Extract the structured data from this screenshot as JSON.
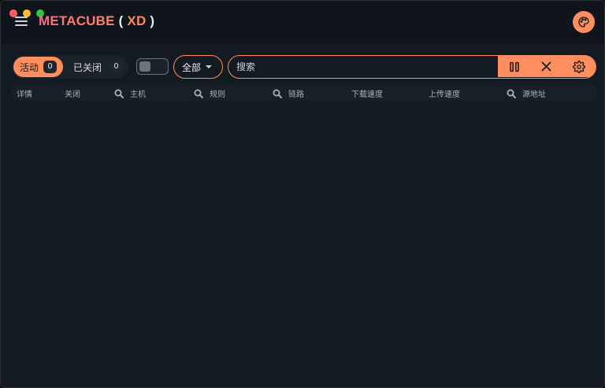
{
  "app": {
    "title_brand": "METACUBE",
    "title_open": "(",
    "title_variant": "XD",
    "title_close": ")"
  },
  "toolbar": {
    "tabs": [
      {
        "label": "活动",
        "count": "0",
        "active": true
      },
      {
        "label": "已关闭",
        "count": "0",
        "active": false
      }
    ],
    "toggle_on": false,
    "filter_select": {
      "value": "全部"
    },
    "search": {
      "placeholder": "搜索",
      "value": ""
    },
    "actions": [
      "pause-icon",
      "close-icon",
      "gear-icon"
    ]
  },
  "table": {
    "columns": [
      {
        "label": "详情",
        "searchable": false
      },
      {
        "label": "关闭",
        "searchable": false
      },
      {
        "label": "主机",
        "searchable": true
      },
      {
        "label": "规则",
        "searchable": true
      },
      {
        "label": "链路",
        "searchable": true
      },
      {
        "label": "下载速度",
        "searchable": false
      },
      {
        "label": "上传速度",
        "searchable": false
      },
      {
        "label": "源地址",
        "searchable": true
      }
    ],
    "rows": []
  },
  "colors": {
    "accent": "#ff8e5e",
    "background": "#141a21",
    "titlebar": "#10151b"
  }
}
